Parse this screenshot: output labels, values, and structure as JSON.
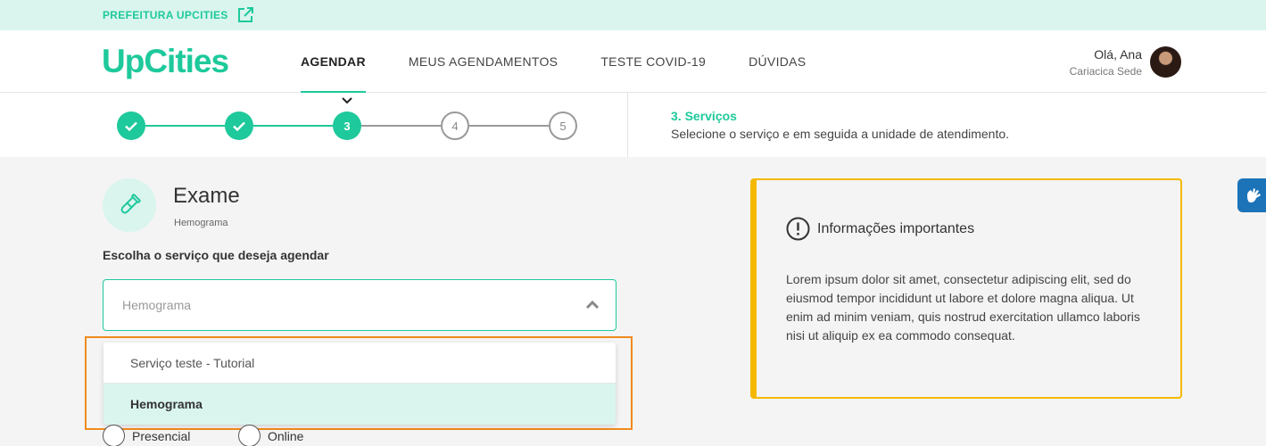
{
  "topbar": {
    "prefeitura_link": "PREFEITURA UPCITIES",
    "external_icon": "external-link-icon"
  },
  "header": {
    "logo": "UpCities",
    "nav": [
      {
        "label": "AGENDAR",
        "active": true
      },
      {
        "label": "MEUS AGENDAMENTOS",
        "active": false
      },
      {
        "label": "TESTE COVID-19",
        "active": false
      },
      {
        "label": "DÚVIDAS",
        "active": false
      }
    ],
    "user": {
      "greeting": "Olá, Ana",
      "location": "Cariacica Sede"
    }
  },
  "stepper": {
    "steps": [
      {
        "label": "",
        "state": "done"
      },
      {
        "label": "",
        "state": "done"
      },
      {
        "label": "3",
        "state": "current"
      },
      {
        "label": "4",
        "state": "todo"
      },
      {
        "label": "5",
        "state": "todo"
      }
    ],
    "colors": {
      "accent": "#1ec99b",
      "inactive": "#999999"
    },
    "current_title": "3. Serviços",
    "current_description": "Selecione o serviço e em seguida a unidade de atendimento."
  },
  "service": {
    "title": "Exame",
    "subtitle": "Hemograma",
    "choose_label": "Escolha o serviço que deseja agendar",
    "select_value": "Hemograma",
    "options": [
      {
        "label": "Serviço teste - Tutorial",
        "selected": false
      },
      {
        "label": "Hemograma",
        "selected": true
      }
    ],
    "modes": [
      {
        "label": "Presencial"
      },
      {
        "label": "Online"
      }
    ]
  },
  "info": {
    "title": "Informações importantes",
    "text": "Lorem ipsum dolor sit amet, consectetur adipiscing elit, sed do eiusmod tempor incididunt ut labore et dolore magna aliqua. Ut enim ad minim veniam, quis nostrud exercitation ullamco laboris nisi ut aliquip ex ea commodo consequat."
  },
  "colors": {
    "brand": "#1ec99b",
    "warning": "#f5b800",
    "highlight": "#f08a1c",
    "accessibility": "#1c73b8"
  }
}
